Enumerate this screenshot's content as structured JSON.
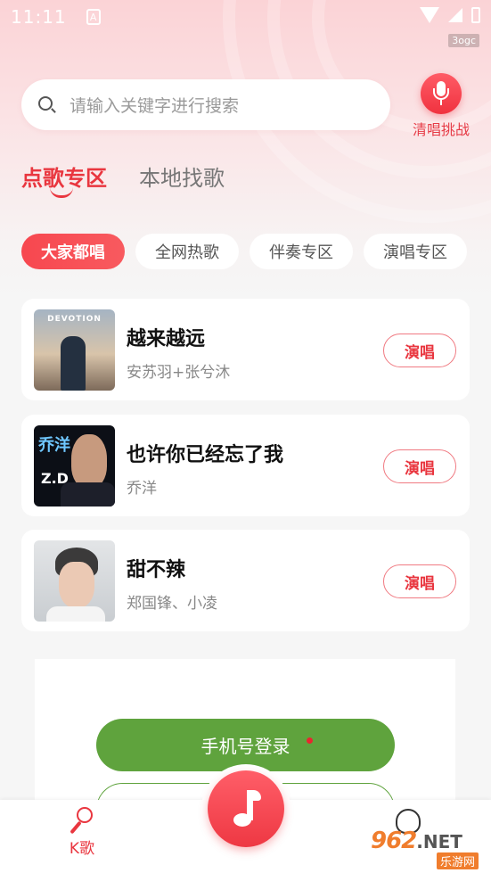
{
  "status_bar": {
    "time": "11:11",
    "notification": "A",
    "network_label": "3ogc"
  },
  "search": {
    "placeholder": "请输入关键字进行搜索"
  },
  "challenge": {
    "label": "清唱挑战"
  },
  "tabs": [
    {
      "label": "点歌专区",
      "active": true
    },
    {
      "label": "本地找歌",
      "active": false
    }
  ],
  "categories": [
    {
      "label": "大家都唱",
      "active": true
    },
    {
      "label": "全网热歌",
      "active": false
    },
    {
      "label": "伴奏专区",
      "active": false
    },
    {
      "label": "演唱专区",
      "active": false
    }
  ],
  "songs": [
    {
      "title": "越来越远",
      "artist": "安苏羽+张兮沐",
      "cover_text": "DEVOTION",
      "action": "演唱"
    },
    {
      "title": "也许你已经忘了我",
      "artist": "乔洋",
      "cover_text": "乔洋",
      "action": "演唱"
    },
    {
      "title": "甜不辣",
      "artist": "郑国锋、小凌",
      "action": "演唱"
    }
  ],
  "login": {
    "phone_label": "手机号登录"
  },
  "bottom_nav": {
    "k_label": "K歌"
  },
  "watermark": {
    "number": "962",
    "suffix": ".NET",
    "sub": "乐游网"
  },
  "colors": {
    "accent": "#e9363f",
    "green": "#5fa33d"
  }
}
